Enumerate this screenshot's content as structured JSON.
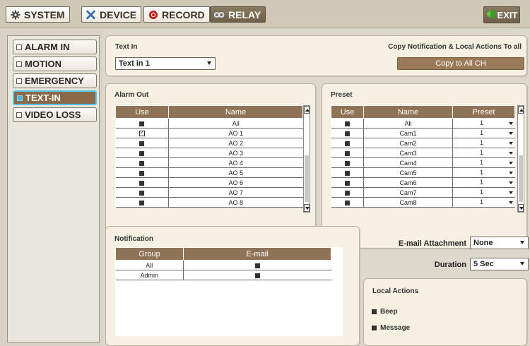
{
  "topbar": {
    "tabs": [
      {
        "label": "SYSTEM",
        "icon": "gear-icon"
      },
      {
        "label": "DEVICE",
        "icon": "tools-icon"
      },
      {
        "label": "RECORD",
        "icon": "record-icon"
      },
      {
        "label": "RELAY",
        "icon": "relay-icon"
      }
    ],
    "active_tab": "RELAY",
    "exit_label": "EXIT"
  },
  "sidebar": {
    "items": [
      {
        "label": "ALARM IN"
      },
      {
        "label": "MOTION"
      },
      {
        "label": "EMERGENCY"
      },
      {
        "label": "TEXT-IN"
      },
      {
        "label": "VIDEO LOSS"
      }
    ],
    "active_item": "TEXT-IN"
  },
  "text_in": {
    "title": "Text In",
    "selected": "Text in 1",
    "copy_title": "Copy Notification & Local Actions To all",
    "copy_button": "Copy to All CH"
  },
  "alarm_out": {
    "title": "Alarm Out",
    "columns": [
      "Use",
      "Name"
    ],
    "rows": [
      {
        "use": false,
        "name": "All"
      },
      {
        "use": true,
        "name": "AO 1"
      },
      {
        "use": false,
        "name": "AO 2"
      },
      {
        "use": false,
        "name": "AO 3"
      },
      {
        "use": false,
        "name": "AO 4"
      },
      {
        "use": false,
        "name": "AO 5"
      },
      {
        "use": false,
        "name": "AO 6"
      },
      {
        "use": false,
        "name": "AO 7"
      },
      {
        "use": false,
        "name": "AO 8"
      }
    ]
  },
  "preset": {
    "title": "Preset",
    "columns": [
      "Use",
      "Name",
      "Preset"
    ],
    "rows": [
      {
        "use": false,
        "name": "All",
        "preset": "1"
      },
      {
        "use": false,
        "name": "Cam1",
        "preset": "1"
      },
      {
        "use": false,
        "name": "Cam2",
        "preset": "1"
      },
      {
        "use": false,
        "name": "Cam3",
        "preset": "1"
      },
      {
        "use": false,
        "name": "Cam4",
        "preset": "1"
      },
      {
        "use": false,
        "name": "Cam5",
        "preset": "1"
      },
      {
        "use": false,
        "name": "Cam6",
        "preset": "1"
      },
      {
        "use": false,
        "name": "Cam7",
        "preset": "1"
      },
      {
        "use": false,
        "name": "Cam8",
        "preset": "1"
      }
    ]
  },
  "notification": {
    "title": "Notification",
    "columns": [
      "Group",
      "E-mail"
    ],
    "rows": [
      {
        "group": "All",
        "email": false
      },
      {
        "group": "Admin",
        "email": false
      }
    ],
    "email_attachment_label": "E-mail Attachment",
    "email_attachment_value": "None",
    "duration_label": "Duration",
    "duration_value": "5 Sec"
  },
  "local_actions": {
    "title": "Local Actions",
    "items": [
      {
        "label": "Beep",
        "checked": false
      },
      {
        "label": "Message",
        "checked": false
      }
    ]
  }
}
